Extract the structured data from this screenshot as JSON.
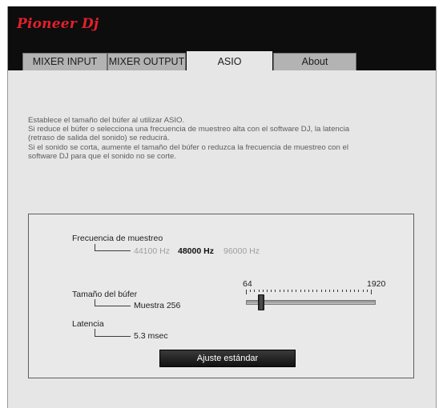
{
  "brand": {
    "logo_text": "Pioneer Dj",
    "logo_color": "#e3202b"
  },
  "tabs": [
    {
      "label": "MIXER INPUT",
      "active": false
    },
    {
      "label": "MIXER OUTPUT",
      "active": false
    },
    {
      "label": "ASIO",
      "active": true
    },
    {
      "label": "About",
      "active": false
    }
  ],
  "description": {
    "lines": [
      "Establece el tamaño del búfer al utilizar ASIO.",
      "Si reduce el búfer o selecciona una frecuencia de muestreo alta con el software DJ, la latencia",
      "(retraso de salida del sonido) se reducirá.",
      "Si el sonido se corta, aumente el tamaño del búfer o reduzca la frecuencia de muestreo con el",
      "software DJ para que el sonido no se corte."
    ]
  },
  "sample_rate": {
    "label": "Frecuencia de muestreo",
    "options": [
      {
        "label": "44100 Hz",
        "selected": false
      },
      {
        "label": "48000 Hz",
        "selected": true
      },
      {
        "label": "96000 Hz",
        "selected": false
      }
    ]
  },
  "buffer": {
    "label": "Tamaño del búfer",
    "value": "Muestra 256",
    "slider_min_label": "64",
    "slider_max_label": "1920",
    "slider_position": 0.09
  },
  "latency": {
    "label": "Latencia",
    "value": "5.3 msec"
  },
  "standard_button_label": "Ajuste estándar"
}
